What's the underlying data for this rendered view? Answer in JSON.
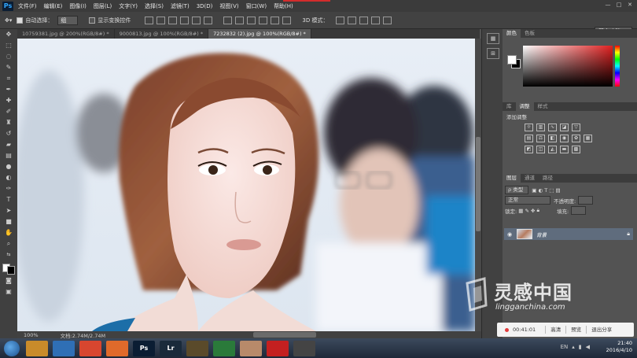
{
  "menubar": {
    "app_logo": "Ps",
    "items": [
      "文件(F)",
      "编辑(E)",
      "图像(I)",
      "图层(L)",
      "文字(Y)",
      "选择(S)",
      "滤镜(T)",
      "3D(D)",
      "视图(V)",
      "窗口(W)",
      "帮助(H)"
    ],
    "window_controls": [
      "—",
      "□",
      "✕"
    ]
  },
  "options": {
    "auto_select_label": "自动选择：",
    "auto_select_value": "组",
    "show_transform_label": "显示变换控件",
    "mode_3d_label": "3D 模式：",
    "workspace": "基本功能"
  },
  "tabs": [
    {
      "label": "10759381.jpg @ 200%(RGB/8#) *",
      "active": false
    },
    {
      "label": "9000813.jpg @ 100%(RGB/8#) *",
      "active": false
    },
    {
      "label": "7232832 (2).jpg @ 100%(RGB/8#) *",
      "active": true
    }
  ],
  "status": {
    "zoom": "100%",
    "doc": "文档:2.74M/2.74M"
  },
  "panels": {
    "color_tabs": [
      "颜色",
      "色板"
    ],
    "adjust_tabs": [
      "库",
      "调整",
      "样式"
    ],
    "adjust_title": "添加调整",
    "layer_tabs": [
      "图层",
      "通道",
      "路径"
    ],
    "kind_label": "ρ 类型",
    "blend_mode": "正常",
    "opacity_label": "不透明度:",
    "lock_label": "锁定:",
    "fill_label": "填充:",
    "layer_name": "背景"
  },
  "recording": {
    "time": "00:41:01",
    "buttons": [
      "高清",
      "预览",
      "退出分享"
    ]
  },
  "watermark": {
    "brand": "灵感中国",
    "url": "lingganchina.com"
  },
  "taskbar": {
    "apps": [
      {
        "label": "",
        "color": "#c98b2a"
      },
      {
        "label": "",
        "color": "#2f6fb5"
      },
      {
        "label": "",
        "color": "#d8462f"
      },
      {
        "label": "",
        "color": "#e06a2b"
      },
      {
        "label": "Ps",
        "color": "#0b1d33"
      },
      {
        "label": "Lr",
        "color": "#1a2a3a"
      },
      {
        "label": "",
        "color": "#5a4a2a"
      },
      {
        "label": "",
        "color": "#2a7a3a"
      },
      {
        "label": "",
        "color": "#b88a6a"
      },
      {
        "label": "",
        "color": "#c42020"
      },
      {
        "label": "",
        "color": "#444444"
      }
    ],
    "time": "21:40",
    "date": "2016/4/10",
    "lang": "EN"
  }
}
